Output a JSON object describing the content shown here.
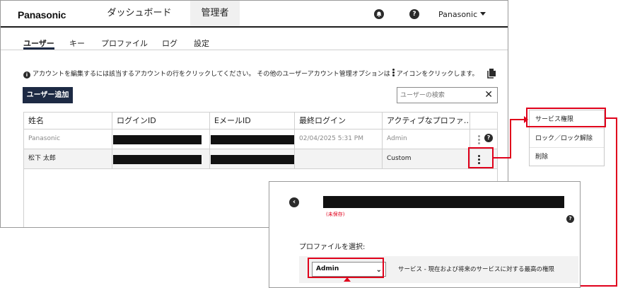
{
  "header": {
    "brand": "Panasonic",
    "nav": [
      "ダッシュボード",
      "管理者"
    ],
    "active_nav": "管理者",
    "user_menu": "Panasonic"
  },
  "tabs": [
    "ユーザー",
    "キー",
    "プロファイル",
    "ログ",
    "設定"
  ],
  "active_tab": "ユーザー",
  "info_text_before": "アカウントを編集するには該当するアカウントの行をクリックしてください。 その他のユーザーアカウント管理オプションは",
  "info_text_after": "アイコンをクリックします。",
  "add_user_button": "ユーザー追加",
  "search": {
    "placeholder": "ユーザーの検索",
    "clear": "✕"
  },
  "table": {
    "columns": [
      "姓名",
      "ログインID",
      "EメールID",
      "最終ログイン",
      "アクティブなプロファ…"
    ],
    "rows": [
      {
        "name": "Panasonic",
        "last_login": "02/04/2025 5:31 PM",
        "profile": "Admin"
      },
      {
        "name": "松下 太郎",
        "last_login": "",
        "profile": "Custom"
      }
    ]
  },
  "context_menu": [
    "サービス権限",
    "ロック／ロック解除",
    "削除"
  ],
  "detail": {
    "unsaved": "(未保存)",
    "profile_label": "プロファイルを選択:",
    "selected_profile": "Admin",
    "profile_description": "サービス - 現在および将来のサービスに対する最高の権限"
  },
  "colors": {
    "navy": "#1d2a44",
    "highlight": "#e0001b"
  }
}
